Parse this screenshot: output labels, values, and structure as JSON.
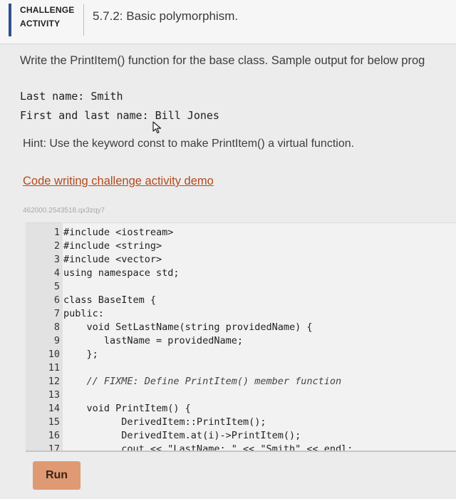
{
  "header": {
    "challenge_line1": "CHALLENGE",
    "challenge_line2": "ACTIVITY",
    "title": "5.7.2: Basic polymorphism."
  },
  "instructions": "Write the PrintItem() function for the base class. Sample output for below prog",
  "sample_output": {
    "line1": "Last name: Smith",
    "line2": "First and last name: Bill Jones"
  },
  "hint": "Hint: Use the keyword const to make PrintItem() a virtual function.",
  "demo_link": "Code writing challenge activity demo",
  "code_id": "462000.2543518.qx3zqy7",
  "code_lines": [
    {
      "num": "1",
      "text": "#include <iostream>"
    },
    {
      "num": "2",
      "text": "#include <string>"
    },
    {
      "num": "3",
      "text": "#include <vector>"
    },
    {
      "num": "4",
      "text": "using namespace std;"
    },
    {
      "num": "5",
      "text": ""
    },
    {
      "num": "6",
      "text": "class BaseItem {"
    },
    {
      "num": "7",
      "text": "public:"
    },
    {
      "num": "8",
      "text": "    void SetLastName(string providedName) {"
    },
    {
      "num": "9",
      "text": "       lastName = providedName;"
    },
    {
      "num": "10",
      "text": "    };"
    },
    {
      "num": "11",
      "text": ""
    },
    {
      "num": "12",
      "text": "    // FIXME: Define PrintItem() member function"
    },
    {
      "num": "13",
      "text": ""
    },
    {
      "num": "14",
      "text": "    void PrintItem() {"
    },
    {
      "num": "15",
      "text": "          DerivedItem::PrintItem();"
    },
    {
      "num": "16",
      "text": "          DerivedItem.at(i)->PrintItem();"
    },
    {
      "num": "17",
      "text": "          cout << \"LastName: \" << \"Smith\" << endl;"
    }
  ],
  "run_button": "Run",
  "colors": {
    "accent_bar": "#2d4f8f",
    "link": "#b34a1c",
    "run_button": "#df9a73"
  }
}
